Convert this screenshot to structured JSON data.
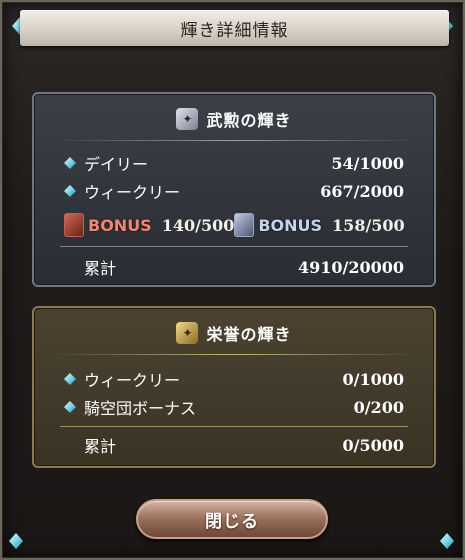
{
  "dialog": {
    "title": "輝き詳細情報",
    "close_label": "閉じる"
  },
  "panel_bushin": {
    "title": "武勲の輝き",
    "rows": [
      {
        "label": "デイリー",
        "value": "54/1000"
      },
      {
        "label": "ウィークリー",
        "value": "667/2000"
      }
    ],
    "bonus_red": {
      "label": "BONUS",
      "value": "140/500"
    },
    "bonus_blue": {
      "label": "BONUS",
      "value": "158/500"
    },
    "total_label": "累計",
    "total_value": "4910/20000"
  },
  "panel_eiyo": {
    "title": "栄誉の輝き",
    "rows": [
      {
        "label": "ウィークリー",
        "value": "0/1000"
      },
      {
        "label": "騎空団ボーナス",
        "value": "0/200"
      }
    ],
    "total_label": "累計",
    "total_value": "0/5000"
  },
  "colors": {
    "title_bar": "#d8d2c6",
    "blue_panel": "#2f3238",
    "gold_panel": "#42392a",
    "gem": "#6fd2e6",
    "bonus_red": "#e88a7a",
    "bonus_blue": "#c6d2ea",
    "close_button": "#9e7460"
  },
  "icons": {
    "corner": "diamond-gem-icon",
    "bushin_header": "hexagon-star-icon",
    "eiyo_header": "gold-hexagon-icon",
    "row_bullet": "diamond-bullet-icon",
    "bonus_red": "red-shield-icon",
    "bonus_blue": "blue-helmet-icon"
  }
}
